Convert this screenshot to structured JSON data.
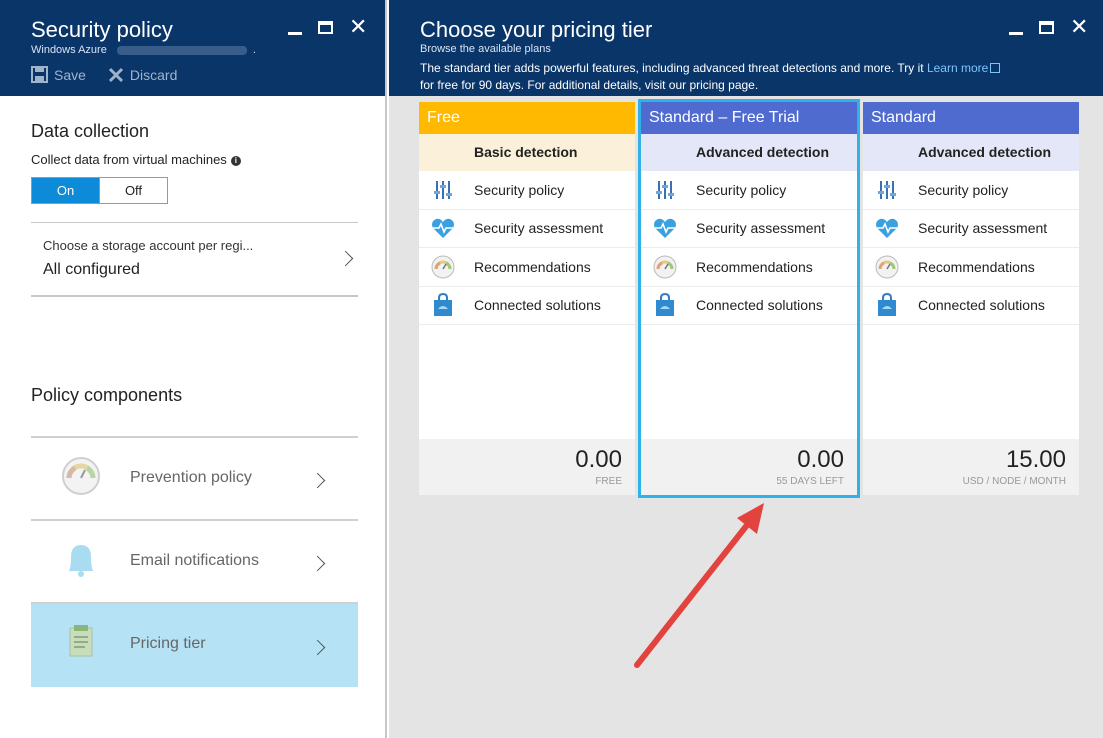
{
  "left": {
    "title": "Security policy",
    "subtitle": "Windows Azure",
    "subtitle_suffix": ".",
    "save_label": "Save",
    "discard_label": "Discard",
    "data_collection_title": "Data collection",
    "collect_label": "Collect data from virtual machines",
    "toggle_on": "On",
    "toggle_off": "Off",
    "toggle_value": "On",
    "storage_label": "Choose a storage account per regi...",
    "storage_value": "All configured",
    "policy_components_title": "Policy components",
    "items": [
      {
        "label": "Prevention policy",
        "icon": "gauge-icon",
        "selected": false
      },
      {
        "label": "Email notifications",
        "icon": "bell-icon",
        "selected": false
      },
      {
        "label": "Pricing tier",
        "icon": "clipboard-icon",
        "selected": true
      }
    ]
  },
  "right": {
    "title": "Choose your pricing tier",
    "subtitle": "Browse the available plans",
    "desc_line1": "The standard tier adds powerful features, including advanced threat detections and more. Try it ",
    "learn_more": "Learn more",
    "desc_line2": "for free for 90 days. For additional details, visit our pricing page.",
    "tiers": [
      {
        "name": "Free",
        "color": "#ffb900",
        "feature_head": "Basic detection",
        "feature_head_bg": "#fbf0d9",
        "features": [
          "Security policy",
          "Security assessment",
          "Recommendations",
          "Connected solutions"
        ],
        "price": "0.00",
        "price_sub": "FREE",
        "selected": false
      },
      {
        "name": "Standard – Free Trial",
        "color": "#4f6bd0",
        "feature_head": "Advanced detection",
        "feature_head_bg": "#e3e7f7",
        "features": [
          "Security policy",
          "Security assessment",
          "Recommendations",
          "Connected solutions"
        ],
        "price": "0.00",
        "price_sub": "55 DAYS LEFT",
        "selected": true
      },
      {
        "name": "Standard",
        "color": "#4f6bd0",
        "feature_head": "Advanced detection",
        "feature_head_bg": "#e3e7f7",
        "features": [
          "Security policy",
          "Security assessment",
          "Recommendations",
          "Connected solutions"
        ],
        "price": "15.00",
        "price_sub": "USD / NODE / MONTH",
        "selected": false
      }
    ],
    "feature_icons": [
      "sliders-icon",
      "heart-pulse-icon",
      "gauge-icon",
      "shopping-bag-icon"
    ]
  },
  "colors": {
    "header_bg": "#0a3568",
    "accent_blue": "#0d8ad8",
    "selected_outline": "#30b2e8",
    "arrow": "#e2433e"
  }
}
